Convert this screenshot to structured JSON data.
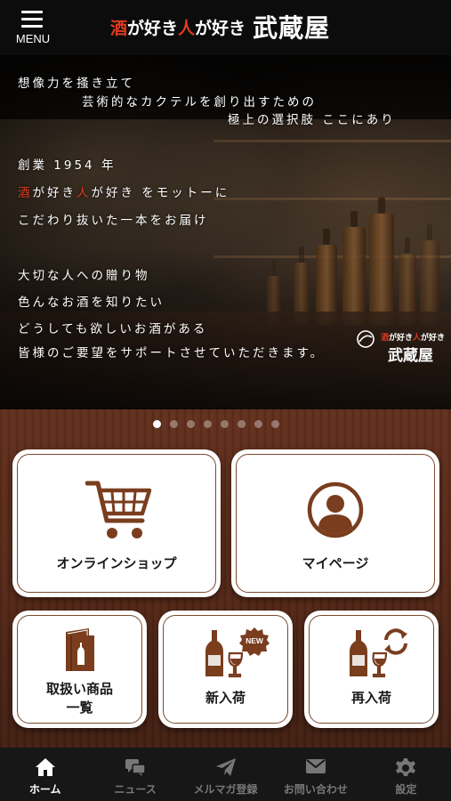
{
  "header": {
    "menu_label": "MENU",
    "brand_red_1": "酒",
    "brand_part_1": "が好き",
    "brand_red_2": "人",
    "brand_part_2": "が好き",
    "brand_name": "武蔵屋"
  },
  "hero": {
    "line1": "想像力を掻き立て",
    "line2": "芸術的なカクテルを創り出すための",
    "line3": "極上の選択肢 ここにあり",
    "line4": "創業 1954 年",
    "line5_red1": "酒",
    "line5_a": "が好き",
    "line5_red2": "人",
    "line5_b": "が好き をモットーに",
    "line6": "こだわり抜いた一本をお届け",
    "line7": "大切な人への贈り物",
    "line8": "色んなお酒を知りたい",
    "line9": "どうしても欲しいお酒がある",
    "line10": "皆様のご要望をサポートさせていただきます。",
    "logo_small_red1": "酒",
    "logo_small_a": "が好き",
    "logo_small_red2": "人",
    "logo_small_b": "が好き",
    "logo_big": "武蔵屋"
  },
  "carousel": {
    "count": 8,
    "active_index": 0
  },
  "tiles": {
    "shop": "オンラインショップ",
    "mypage": "マイページ",
    "catalog_line1": "取扱い商品",
    "catalog_line2": "一覧",
    "new_arrivals": "新入荷",
    "new_badge": "NEW",
    "restock": "再入荷"
  },
  "nav": {
    "home": "ホーム",
    "news": "ニュース",
    "mail": "メルマガ登録",
    "contact": "お問い合わせ",
    "settings": "設定"
  },
  "colors": {
    "accent_brown": "#7a3d1e",
    "brand_red": "#e23a1f",
    "nav_bg": "#171717",
    "nav_active": "#ffffff",
    "nav_inactive": "#777777"
  }
}
